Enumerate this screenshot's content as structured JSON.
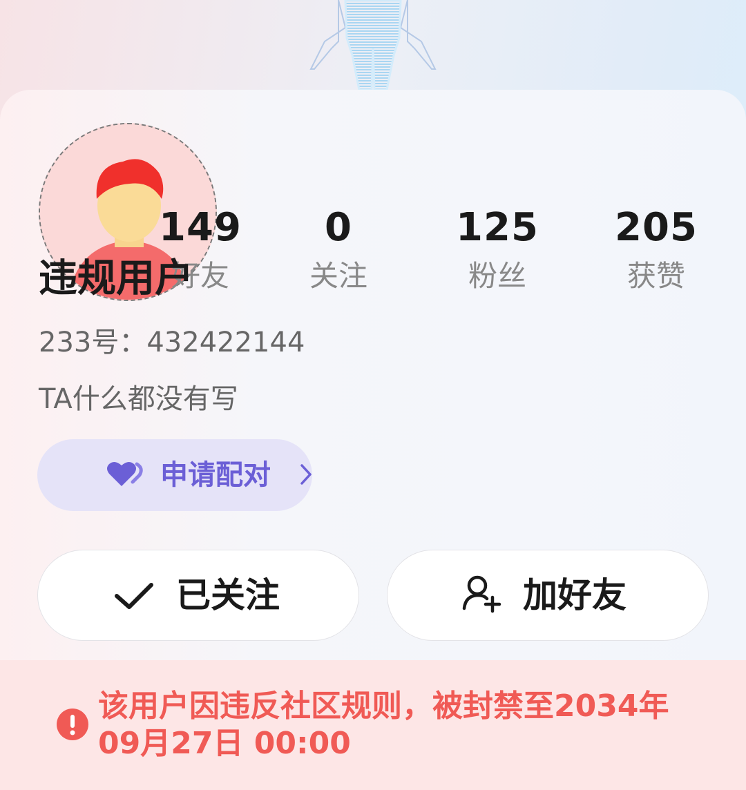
{
  "profile": {
    "name": "违规用户",
    "uid_text": "233号：432422144",
    "bio": "TA什么都没有写"
  },
  "stats": [
    {
      "value": "149",
      "label": "好友"
    },
    {
      "value": "0",
      "label": "关注"
    },
    {
      "value": "125",
      "label": "粉丝"
    },
    {
      "value": "205",
      "label": "获赞"
    }
  ],
  "pair_button": {
    "label": "申请配对",
    "icon": "heart-icon",
    "chevron": "chevron-right-icon"
  },
  "actions": {
    "follow_label": "已关注",
    "follow_icon": "check-icon",
    "add_friend_label": "加好友",
    "add_friend_icon": "add-user-icon"
  },
  "ban_notice": {
    "text": "该用户因违反社区规则，被封禁至2034年09月27日 00:00",
    "icon": "exclamation-icon"
  },
  "colors": {
    "accent_purple": "#6b5fd6",
    "pair_bg": "#e5e3f8",
    "warning_red": "#f05a55",
    "warning_bg": "#fde6e6"
  }
}
